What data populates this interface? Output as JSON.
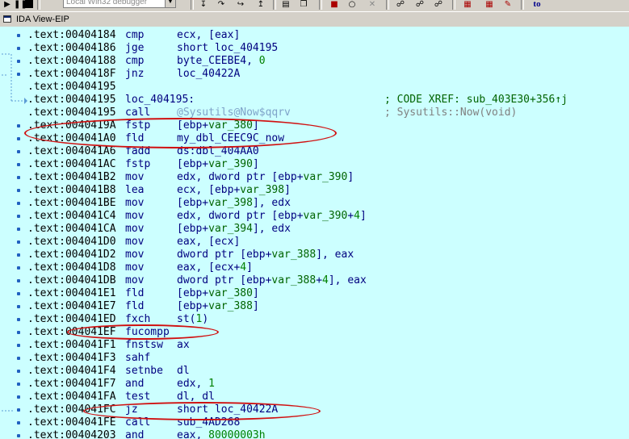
{
  "toolbar": {
    "debugger": "Local Win32 debugger",
    "buttons": [
      "play-icon",
      "pause-icon",
      "stop-icon",
      "step-into-icon",
      "step-over-icon",
      "run-to-cursor-icon",
      "step-out-icon",
      "breakpoint-list-icon",
      "copy-icon",
      "watch-icon",
      "close-icon",
      "stack-icon",
      "thread-icon",
      "module-icon",
      "memory-icon",
      "registers-icon",
      "edit-icon",
      "to-icon"
    ],
    "to_label": "to"
  },
  "window": {
    "title": "IDA View-EIP"
  },
  "disasm": {
    "rows": [
      {
        "addr": ".text:00404184",
        "mnem": "cmp",
        "ops": "ecx, [eax]",
        "bullet": true
      },
      {
        "addr": ".text:00404186",
        "mnem": "jge",
        "ops": "short loc_404195",
        "bullet": true
      },
      {
        "addr": ".text:00404188",
        "mnem": "cmp",
        "ops": "byte_CEEBE4, 0",
        "bullet": true
      },
      {
        "addr": ".text:0040418F",
        "mnem": "jnz",
        "ops": "loc_40422A",
        "bullet": true
      },
      {
        "addr": ".text:00404195",
        "mnem": "",
        "ops": "",
        "bullet": false
      },
      {
        "addr": ".text:00404195",
        "label": "loc_404195:",
        "cmt": "; CODE XREF: sub_403E30+356↑j",
        "cmt_green": true,
        "bullet": false
      },
      {
        "addr": ".text:00404195",
        "mnem": "call",
        "ops": "@Sysutils@Now$qqrv",
        "call": true,
        "cmt": "; Sysutils::Now(void)",
        "bullet": false
      },
      {
        "addr": ".text:0040419A",
        "mnem": "fstp",
        "ops": "[ebp+var_380]",
        "bullet": true
      },
      {
        "addr": ".text:004041A0",
        "mnem": "fld",
        "ops": "my_dbl_CEEC9C_now",
        "bullet": true
      },
      {
        "addr": ".text:004041A6",
        "mnem": "fadd",
        "ops": "ds:dbl_404AA0",
        "bullet": true
      },
      {
        "addr": ".text:004041AC",
        "mnem": "fstp",
        "ops": "[ebp+var_390]",
        "bullet": true
      },
      {
        "addr": ".text:004041B2",
        "mnem": "mov",
        "ops": "edx, dword ptr [ebp+var_390]",
        "bullet": true
      },
      {
        "addr": ".text:004041B8",
        "mnem": "lea",
        "ops": "ecx, [ebp+var_398]",
        "bullet": true
      },
      {
        "addr": ".text:004041BE",
        "mnem": "mov",
        "ops": "[ebp+var_398], edx",
        "bullet": true
      },
      {
        "addr": ".text:004041C4",
        "mnem": "mov",
        "ops": "edx, dword ptr [ebp+var_390+4]",
        "bullet": true
      },
      {
        "addr": ".text:004041CA",
        "mnem": "mov",
        "ops": "[ebp+var_394], edx",
        "bullet": true
      },
      {
        "addr": ".text:004041D0",
        "mnem": "mov",
        "ops": "eax, [ecx]",
        "bullet": true
      },
      {
        "addr": ".text:004041D2",
        "mnem": "mov",
        "ops": "dword ptr [ebp+var_388], eax",
        "bullet": true
      },
      {
        "addr": ".text:004041D8",
        "mnem": "mov",
        "ops": "eax, [ecx+4]",
        "bullet": true
      },
      {
        "addr": ".text:004041DB",
        "mnem": "mov",
        "ops": "dword ptr [ebp+var_388+4], eax",
        "bullet": true
      },
      {
        "addr": ".text:004041E1",
        "mnem": "fld",
        "ops": "[ebp+var_380]",
        "bullet": true
      },
      {
        "addr": ".text:004041E7",
        "mnem": "fld",
        "ops": "[ebp+var_388]",
        "bullet": true
      },
      {
        "addr": ".text:004041ED",
        "mnem": "fxch",
        "ops": "st(1)",
        "bullet": true
      },
      {
        "addr": ".text:004041EF",
        "mnem": "fucompp",
        "ops": "",
        "bullet": true
      },
      {
        "addr": ".text:004041F1",
        "mnem": "fnstsw",
        "ops": "ax",
        "bullet": true
      },
      {
        "addr": ".text:004041F3",
        "mnem": "sahf",
        "ops": "",
        "bullet": true
      },
      {
        "addr": ".text:004041F4",
        "mnem": "setnbe",
        "ops": "dl",
        "bullet": true
      },
      {
        "addr": ".text:004041F7",
        "mnem": "and",
        "ops": "edx, 1",
        "bullet": true
      },
      {
        "addr": ".text:004041FA",
        "mnem": "test",
        "ops": "dl, dl",
        "bullet": true
      },
      {
        "addr": ".text:004041FC",
        "mnem": "jz",
        "ops": "short loc_40422A",
        "bullet": true
      },
      {
        "addr": ".text:004041FE",
        "mnem": "call",
        "ops": "sub_4AD268",
        "bullet": true
      },
      {
        "addr": ".text:00404203",
        "mnem": "and",
        "ops": "eax, 80000003h",
        "bullet": true
      }
    ]
  },
  "colors": {
    "background": "#ccffff",
    "annotation_ring": "#d01010",
    "code_text": "#000080",
    "comment": "#808080"
  }
}
